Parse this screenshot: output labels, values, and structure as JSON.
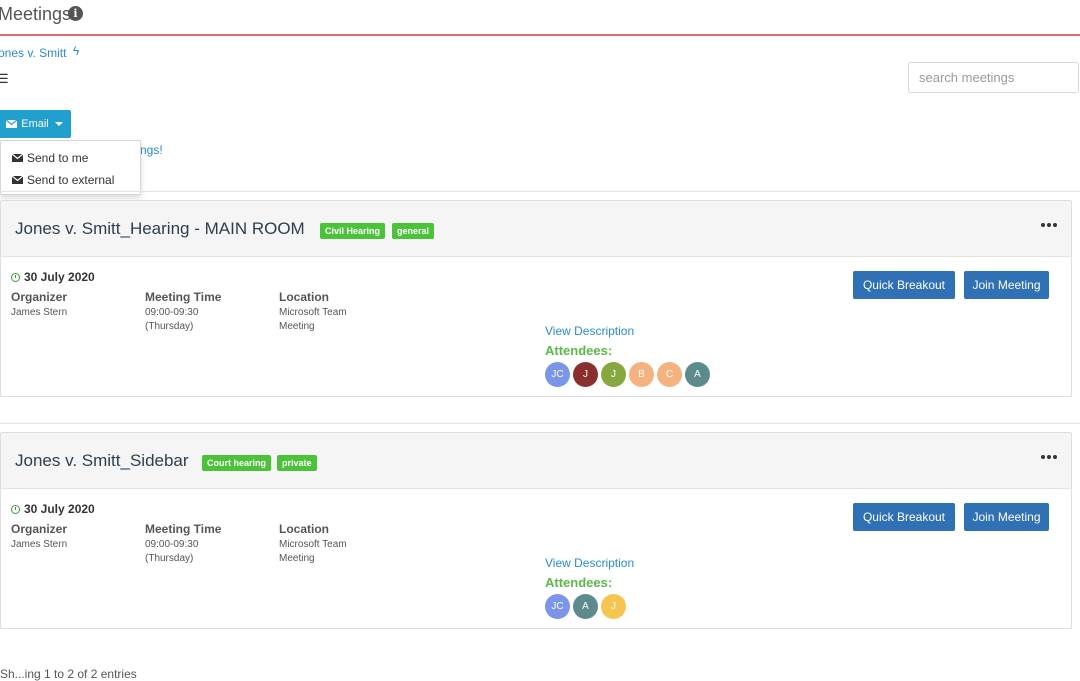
{
  "header": {
    "title": "Meetings"
  },
  "breadcrumb": "ones v. Smitt",
  "search": {
    "placeholder": "search meetings"
  },
  "email_button": {
    "label": "Email"
  },
  "dropdown": {
    "items": [
      "Send to me",
      "Send to external"
    ]
  },
  "partially_hidden_text": "ngs!",
  "meetings": [
    {
      "title": "Jones v. Smitt_Hearing - MAIN ROOM",
      "tags": [
        "Civil Hearing",
        "general"
      ],
      "date": "30 July 2020",
      "organizer_label": "Organizer",
      "organizer": "James Stern",
      "time_label": "Meeting Time",
      "time": "09:00-09:30",
      "day": "(Thursday)",
      "location_label": "Location",
      "location_line1": "Microsoft Team",
      "location_line2": "Meeting",
      "quick_breakout": "Quick Breakout",
      "join": "Join Meeting",
      "view_description": "View Description",
      "attendees_label": "Attendees:",
      "attendees": [
        {
          "initials": "JC",
          "color": "#7b96e8"
        },
        {
          "initials": "J",
          "color": "#8a2e2e"
        },
        {
          "initials": "J",
          "color": "#86a83e"
        },
        {
          "initials": "B",
          "color": "#f4b27e"
        },
        {
          "initials": "C",
          "color": "#f4b27e"
        },
        {
          "initials": "A",
          "color": "#5d8a8c"
        }
      ]
    },
    {
      "title": "Jones v. Smitt_Sidebar",
      "tags": [
        "Court hearing",
        "private"
      ],
      "date": "30 July 2020",
      "organizer_label": "Organizer",
      "organizer": "James Stern",
      "time_label": "Meeting Time",
      "time": "09:00-09:30",
      "day": "(Thursday)",
      "location_label": "Location",
      "location_line1": "Microsoft Team",
      "location_line2": "Meeting",
      "quick_breakout": "Quick Breakout",
      "join": "Join Meeting",
      "view_description": "View Description",
      "attendees_label": "Attendees:",
      "attendees": [
        {
          "initials": "JC",
          "color": "#7b96e8"
        },
        {
          "initials": "A",
          "color": "#5d8a8c"
        },
        {
          "initials": "J",
          "color": "#f7c44f"
        }
      ]
    }
  ],
  "footer_text": "Sh...ing 1 to 2 of 2 entries",
  "colors": {
    "accent_line": "#e06b6b",
    "primary_button": "#3071b5",
    "email_button": "#22a0cd",
    "tag": "#4cc23a",
    "link": "#2a8ac9"
  },
  "icons": [
    "info-icon",
    "bolt-icon",
    "settings-icon",
    "envelope-icon",
    "clock-icon",
    "more-icon"
  ]
}
